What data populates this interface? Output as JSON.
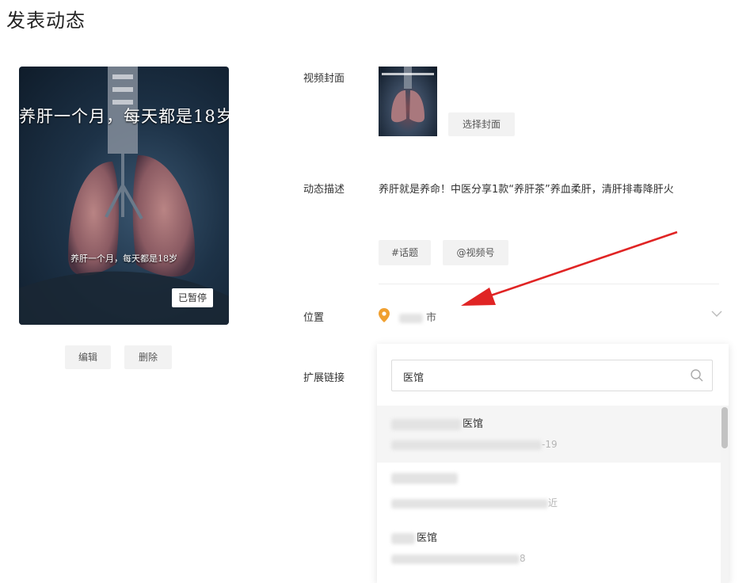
{
  "page_title": "发表动态",
  "video": {
    "overlay_title": "养肝一个月，每天都是18岁",
    "subtitle": "养肝一个月，每天都是18岁",
    "paused_label": "已暂停",
    "edit_label": "编辑",
    "delete_label": "删除"
  },
  "form": {
    "cover_label": "视频封面",
    "choose_cover_label": "选择封面",
    "desc_label": "动态描述",
    "desc_text": "养肝就是养命！中医分享1款“养肝茶”养血柔肝，清肝排毒降肝火",
    "topic_label": "#话题",
    "mention_label": "@视频号",
    "location_label": "位置",
    "location_value": "市",
    "ext_link_label": "扩展链接"
  },
  "dropdown": {
    "search_value": "医馆",
    "results": [
      {
        "name": "医馆",
        "addr": "-19"
      },
      {
        "name": "",
        "addr": "近"
      },
      {
        "name": "医馆",
        "addr": "8"
      }
    ]
  },
  "colors": {
    "accent_pin": "#f0a030",
    "annotation_red": "#e02424"
  },
  "icons": [
    "location-pin-icon",
    "chevron-down-icon",
    "search-icon"
  ]
}
